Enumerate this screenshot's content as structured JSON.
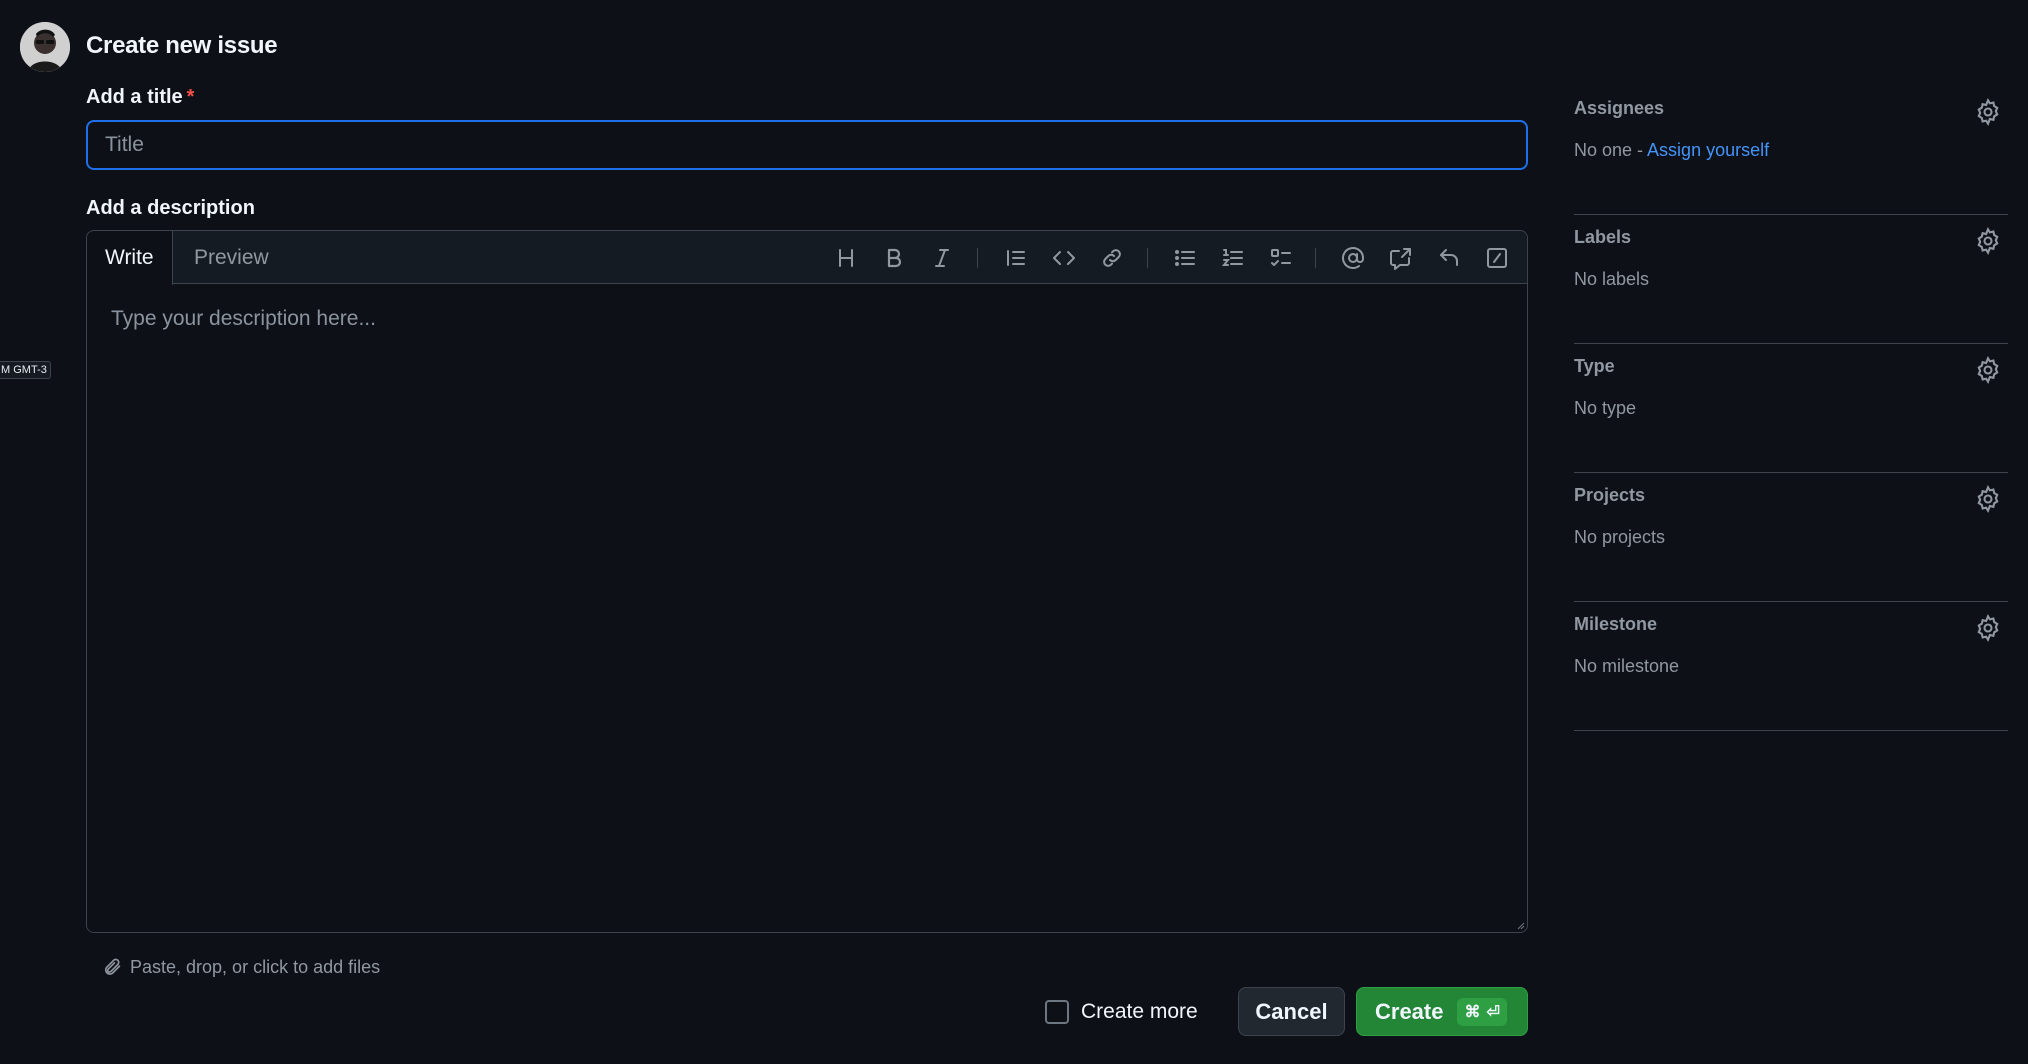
{
  "header": {
    "title": "Create new issue"
  },
  "time_badge": "M GMT-3",
  "form": {
    "title_label": "Add a title",
    "required_mark": "*",
    "title_placeholder": "Title",
    "description_label": "Add a description",
    "tabs": [
      {
        "label": "Write",
        "active": true
      },
      {
        "label": "Preview",
        "active": false
      }
    ],
    "toolbar_icons": [
      "heading-icon",
      "bold-icon",
      "italic-icon",
      "quote-icon",
      "code-icon",
      "link-icon",
      "unordered-list-icon",
      "ordered-list-icon",
      "task-list-icon",
      "mention-icon",
      "cross-reference-icon",
      "saved-replies-icon",
      "slash-commands-icon"
    ],
    "description_placeholder": "Type your description here...",
    "attach_text": "Paste, drop, or click to add files"
  },
  "footer": {
    "create_more_label": "Create more",
    "create_more_checked": false,
    "cancel_label": "Cancel",
    "create_label": "Create",
    "create_shortcut_cmd": "⌘",
    "create_shortcut_enter": "⏎"
  },
  "sidebar": {
    "sections": [
      {
        "title": "Assignees",
        "value": "No one - ",
        "link": "Assign yourself"
      },
      {
        "title": "Labels",
        "value": "No labels"
      },
      {
        "title": "Type",
        "value": "No type"
      },
      {
        "title": "Projects",
        "value": "No projects"
      },
      {
        "title": "Milestone",
        "value": "No milestone"
      }
    ]
  },
  "colors": {
    "background": "#0d1117",
    "focus_border": "#1f6feb",
    "create_button": "#238636",
    "link": "#4493f8",
    "required": "#f85149"
  }
}
